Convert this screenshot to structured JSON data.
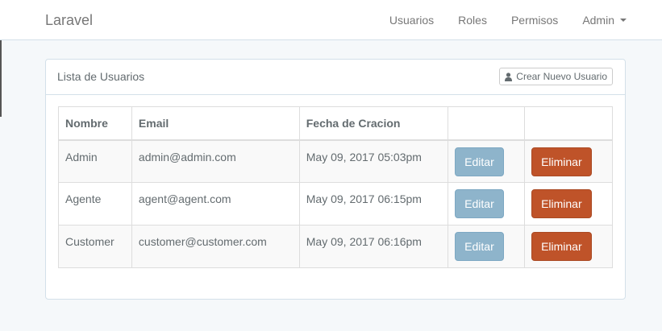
{
  "navbar": {
    "brand": "Laravel",
    "links": [
      "Usuarios",
      "Roles",
      "Permisos"
    ],
    "user_menu": "Admin"
  },
  "panel": {
    "title": "Lista de Usuarios",
    "new_button": "Crear Nuevo Usuario",
    "new_button_icon": "user-icon"
  },
  "table": {
    "headers": [
      "Nombre",
      "Email",
      "Fecha de Cracion",
      "",
      ""
    ],
    "rows": [
      {
        "name": "Admin",
        "email": "admin@admin.com",
        "date": "May 09, 2017 05:03pm",
        "edit": "Editar",
        "delete": "Eliminar"
      },
      {
        "name": "Agente",
        "email": "agent@agent.com",
        "date": "May 09, 2017 06:15pm",
        "edit": "Editar",
        "delete": "Eliminar"
      },
      {
        "name": "Customer",
        "email": "customer@customer.com",
        "date": "May 09, 2017 06:16pm",
        "edit": "Editar",
        "delete": "Eliminar"
      }
    ]
  },
  "colors": {
    "edit_button": "#8eb4cb",
    "delete_button": "#bf5329",
    "background": "#f5f8fa"
  }
}
